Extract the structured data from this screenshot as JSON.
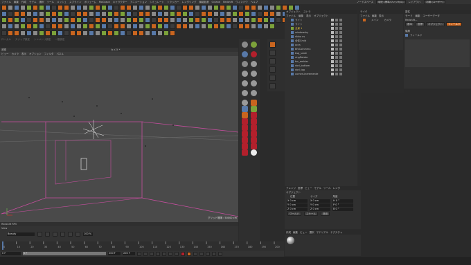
{
  "menu": [
    "ファイル",
    "編集",
    "作成",
    "モデル",
    "選択",
    "ツール",
    "メッシュ",
    "スプライン",
    "ボリューム",
    "MoGraph",
    "キャラクター",
    "アニメーション",
    "シミュレート",
    "トラッカー",
    "レンダリング",
    "機能拡張",
    "Octane",
    "Redshift",
    "ウィンドウ",
    "ヘルプ"
  ],
  "right_menu": {
    "node_space": "ノードスペース",
    "node_value": "現在 (標準/フィジカル)",
    "layout_label": "レイアウト:",
    "layout_value": "初期 (ユーザー)"
  },
  "viewport": {
    "panel_label": "透視",
    "tabs": [
      "ビュー",
      "カメラ",
      "表示",
      "オプション",
      "フィルタ",
      "パネル"
    ],
    "camera_label": "カメラ *",
    "grid_label": "グリッド間隔 : 50000 cm",
    "subtoolbar": [
      "ローカル",
      "スナップ設定",
      "シンメトリ設定",
      "一般設定"
    ]
  },
  "rs_bar": {
    "title": "Redshift RPV",
    "view": "View",
    "beauty": "Beauty",
    "zoom": "100 %"
  },
  "object_manager": {
    "title": "オブジェクト",
    "tab2": "ストラ",
    "menu": [
      "ファイル",
      "編集",
      "表示",
      "オブジェクト"
    ],
    "objects": [
      "ライト",
      "ライト",
      "全景 1",
      "windowsky",
      "ribbo ns",
      "全体Cmid",
      "ocra",
      "BfxCoinmmu",
      "bsg_scale",
      "ringRotate",
      "tor_ambier",
      "dorl_bottom",
      "dorl_top",
      "cornerLineremente"
    ]
  },
  "attr_manager": {
    "title": "属性",
    "tabs": [
      "モード",
      "編集",
      "ユーザーデータ"
    ],
    "subtitle": "Redshift...",
    "tabs2": [
      "基本",
      "座標",
      "オブジェクト",
      "フィールド"
    ]
  },
  "take_panel": {
    "title": "テイク",
    "tabs": [
      "ファイル",
      "編集",
      "表示"
    ],
    "row": "メイン",
    "col": "カメラ"
  },
  "layer_panel": {
    "title": "階層",
    "tab": "フィールド"
  },
  "coord_panel": {
    "tabs": [
      "アレンジ",
      "座標",
      "ビュー",
      "モデル",
      "ツール",
      "レンダ"
    ],
    "headers": [
      "位置",
      "サイズ",
      "角度"
    ],
    "rows": [
      [
        "X 0 cm",
        "X 0 cm",
        "H 0 °"
      ],
      [
        "Y 0 cm",
        "Y 0 cm",
        "P 0 °"
      ],
      [
        "Z 0 cm",
        "Z 0 cm",
        "B 0 °"
      ]
    ],
    "mode1": "ワールド",
    "mode2": "スケール",
    "apply": "適用",
    "panel_label": "オブジェクト"
  },
  "material_panel": {
    "tabs": [
      "作成",
      "編集",
      "ビュー",
      "選択",
      "マテリアル",
      "テクスチャ"
    ]
  },
  "timeline": {
    "ticks": [
      "0",
      "10",
      "20",
      "30",
      "40",
      "50",
      "60",
      "70",
      "80",
      "90",
      "100",
      "110",
      "120",
      "130",
      "140",
      "150",
      "160",
      "170",
      "180",
      "190",
      "200"
    ],
    "frame_start": "0 F",
    "frame_cur": "0 F",
    "frame_end": "200 F",
    "frame_end2": "200 F"
  },
  "accent": "#c9651f",
  "selection_color": "#c84ea0"
}
